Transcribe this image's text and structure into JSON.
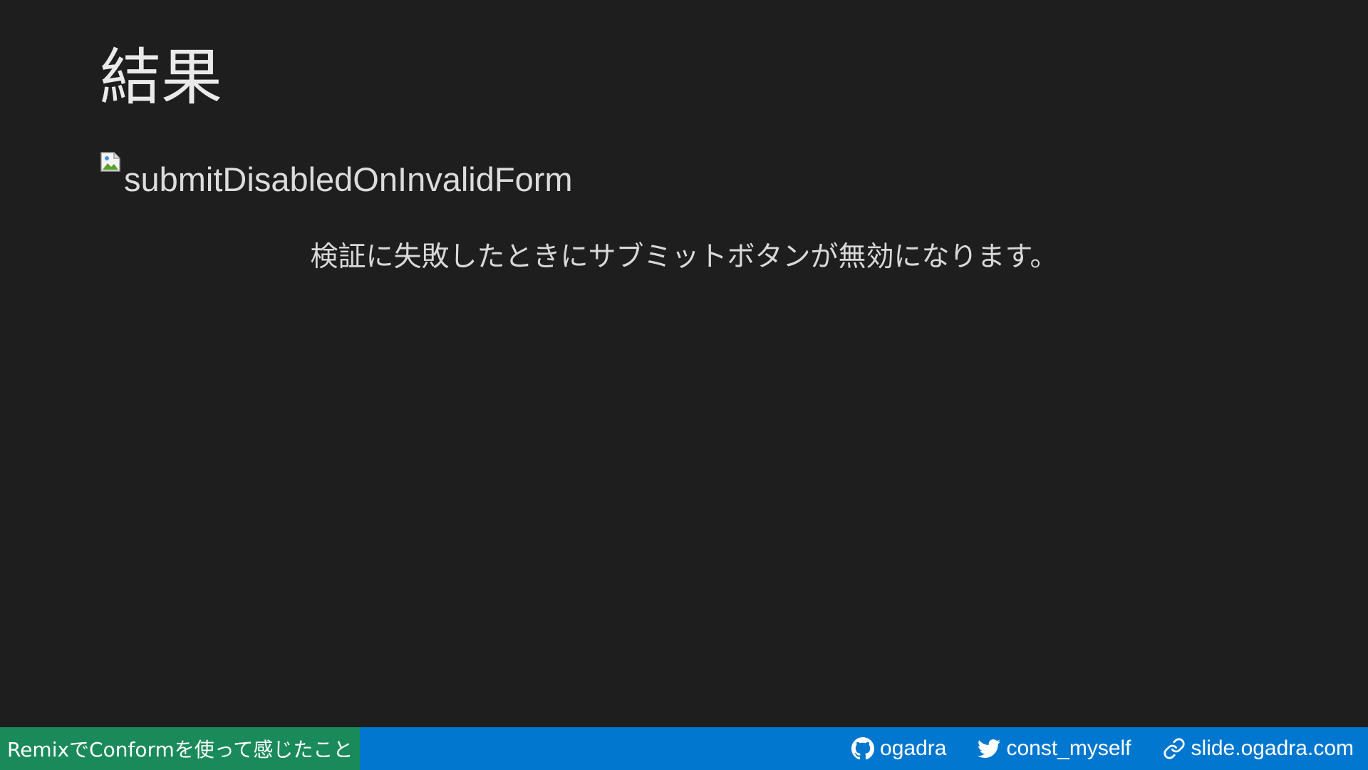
{
  "slide": {
    "title": "結果",
    "image_alt": "submitDisabledOnInvalidForm",
    "caption": "検証に失敗したときにサブミットボタンが無効になります。"
  },
  "footer": {
    "presentation_title": "RemixでConformを使って感じたこと",
    "links": [
      {
        "icon": "github-icon",
        "label": "ogadra"
      },
      {
        "icon": "twitter-icon",
        "label": "const_myself"
      },
      {
        "icon": "link-icon",
        "label": "slide.ogadra.com"
      }
    ]
  },
  "colors": {
    "background": "#1e1e1e",
    "footer_bar": "#0277cf",
    "footer_title_bg": "#1a8a5a",
    "text": "#e6e6e6"
  }
}
